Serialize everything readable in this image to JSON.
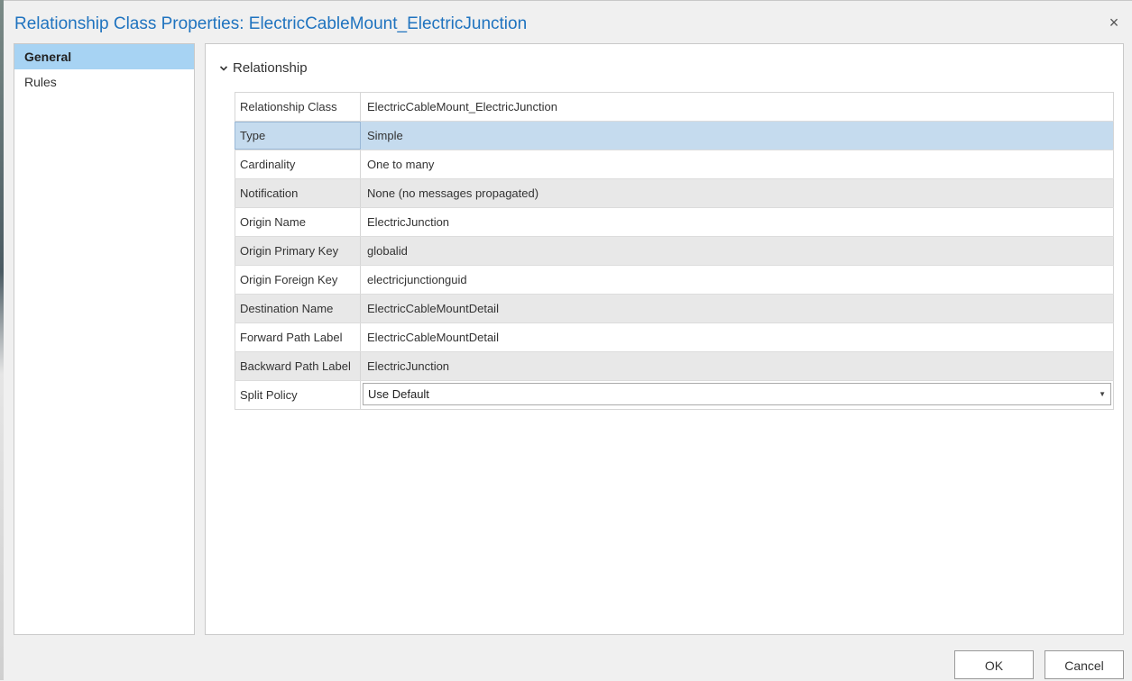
{
  "window": {
    "title": "Relationship Class Properties: ElectricCableMount_ElectricJunction",
    "close_icon": "×"
  },
  "nav": {
    "items": [
      {
        "label": "General",
        "active": true
      },
      {
        "label": "Rules",
        "active": false
      }
    ]
  },
  "section": {
    "title": "Relationship",
    "icon": "chevron-down-icon"
  },
  "properties": [
    {
      "label": "Relationship Class",
      "value": "ElectricCableMount_ElectricJunction"
    },
    {
      "label": "Type",
      "value": "Simple"
    },
    {
      "label": "Cardinality",
      "value": "One to many"
    },
    {
      "label": "Notification",
      "value": "None (no messages propagated)"
    },
    {
      "label": "Origin Name",
      "value": "ElectricJunction"
    },
    {
      "label": "Origin Primary Key",
      "value": "globalid"
    },
    {
      "label": "Origin Foreign Key",
      "value": "electricjunctionguid"
    },
    {
      "label": "Destination Name",
      "value": "ElectricCableMountDetail"
    },
    {
      "label": "Forward Path Label",
      "value": "ElectricCableMountDetail"
    },
    {
      "label": "Backward Path Label",
      "value": "ElectricJunction"
    },
    {
      "label": "Split Policy",
      "value": "Use Default"
    }
  ],
  "buttons": {
    "ok": "OK",
    "cancel": "Cancel"
  },
  "colors": {
    "title": "#1f73bf",
    "nav_active": "#a7d3f3",
    "row_selected": "#c5dbee",
    "row_shaded": "#e8e8e8"
  }
}
